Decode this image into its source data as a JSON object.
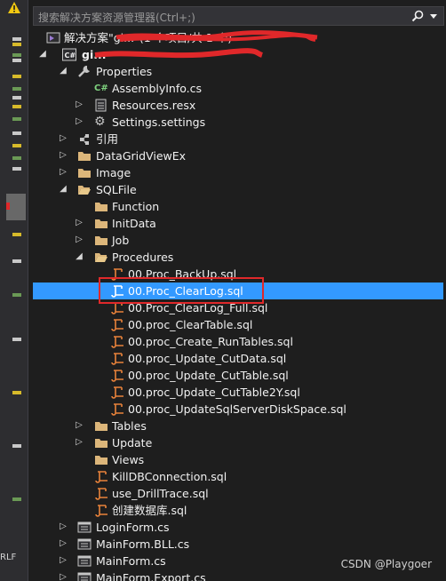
{
  "search": {
    "placeholder": "搜索解决方案资源管理器(Ctrl+;)"
  },
  "gutter": {
    "line_ending": "RLF"
  },
  "tree": {
    "solution_label": "解决方案\"gi...\"(1 个项目/共 1 个)",
    "project_label": "gi...",
    "items": [
      {
        "label": "Properties",
        "icon": "wrench-icon"
      },
      {
        "label": "AssemblyInfo.cs",
        "icon": "csharp-icon"
      },
      {
        "label": "Resources.resx",
        "icon": "resx-icon"
      },
      {
        "label": "Settings.settings",
        "icon": "gear-icon"
      },
      {
        "label": "引用",
        "icon": "references-icon"
      },
      {
        "label": "DataGridViewEx",
        "icon": "folder-icon"
      },
      {
        "label": "Image",
        "icon": "folder-icon"
      },
      {
        "label": "SQLFile",
        "icon": "folder-open-icon"
      },
      {
        "label": "Function",
        "icon": "folder-icon"
      },
      {
        "label": "InitData",
        "icon": "folder-icon"
      },
      {
        "label": "Job",
        "icon": "folder-icon"
      },
      {
        "label": "Procedures",
        "icon": "folder-open-icon"
      },
      {
        "label": "00.Proc_BackUp.sql",
        "icon": "sql-file-icon"
      },
      {
        "label": "00.Proc_ClearLog.sql",
        "icon": "sql-file-icon"
      },
      {
        "label": "00.Proc_ClearLog_Full.sql",
        "icon": "sql-file-icon"
      },
      {
        "label": "00.proc_ClearTable.sql",
        "icon": "sql-file-icon"
      },
      {
        "label": "00.proc_Create_RunTables.sql",
        "icon": "sql-file-icon"
      },
      {
        "label": "00.proc_Update_CutData.sql",
        "icon": "sql-file-icon"
      },
      {
        "label": "00.proc_Update_CutTable.sql",
        "icon": "sql-file-icon"
      },
      {
        "label": "00.proc_Update_CutTable2Y.sql",
        "icon": "sql-file-icon"
      },
      {
        "label": "00.proc_UpdateSqlServerDiskSpace.sql",
        "icon": "sql-file-icon"
      },
      {
        "label": "Tables",
        "icon": "folder-icon"
      },
      {
        "label": "Update",
        "icon": "folder-icon"
      },
      {
        "label": "Views",
        "icon": "folder-icon"
      },
      {
        "label": "KillDBConnection.sql",
        "icon": "sql-file-icon"
      },
      {
        "label": "use_DrillTrace.sql",
        "icon": "sql-file-icon"
      },
      {
        "label": "创建数据库.sql",
        "icon": "sql-file-icon"
      },
      {
        "label": "LoginForm.cs",
        "icon": "form-icon"
      },
      {
        "label": "MainForm.BLL.cs",
        "icon": "form-icon"
      },
      {
        "label": "MainForm.cs",
        "icon": "form-icon"
      },
      {
        "label": "MainForm.Export.cs",
        "icon": "form-icon"
      }
    ]
  },
  "watermark": "CSDN @Playgoer",
  "colors": {
    "background": "#1e1e1e",
    "selection": "#3399ff",
    "folder": "#dcb67a",
    "sql": "#e8823a",
    "annotation": "#e0282a"
  }
}
